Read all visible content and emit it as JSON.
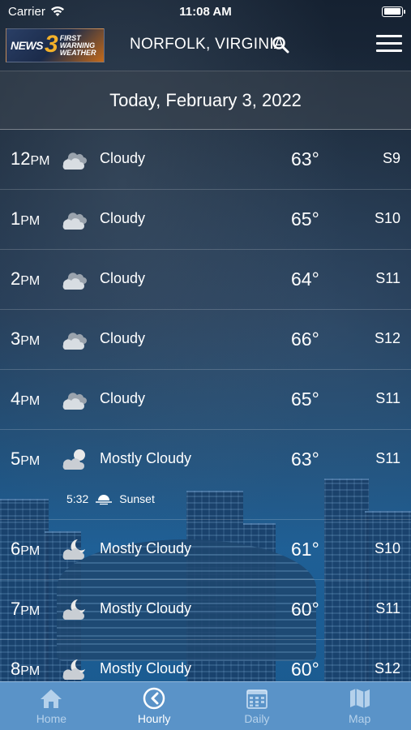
{
  "status_bar": {
    "carrier": "Carrier",
    "time": "11:08 AM"
  },
  "header": {
    "logo_news": "NEWS",
    "logo_number": "3",
    "logo_line1": "FIRST",
    "logo_line2": "WARNING",
    "logo_line3": "WEATHER",
    "location": "NORFOLK, VIRGINIA"
  },
  "date_label": "Today, February 3, 2022",
  "hours": [
    {
      "hour": "12",
      "ampm": "PM",
      "icon": "cloudy-icon",
      "condition": "Cloudy",
      "temp": "63°",
      "wind": "S9"
    },
    {
      "hour": "1",
      "ampm": "PM",
      "icon": "cloudy-icon",
      "condition": "Cloudy",
      "temp": "65°",
      "wind": "S10"
    },
    {
      "hour": "2",
      "ampm": "PM",
      "icon": "cloudy-icon",
      "condition": "Cloudy",
      "temp": "64°",
      "wind": "S11"
    },
    {
      "hour": "3",
      "ampm": "PM",
      "icon": "cloudy-icon",
      "condition": "Cloudy",
      "temp": "66°",
      "wind": "S12"
    },
    {
      "hour": "4",
      "ampm": "PM",
      "icon": "cloudy-icon",
      "condition": "Cloudy",
      "temp": "65°",
      "wind": "S11"
    },
    {
      "hour": "5",
      "ampm": "PM",
      "icon": "mostly-cloudy-day-icon",
      "condition": "Mostly Cloudy",
      "temp": "63°",
      "wind": "S11"
    },
    {
      "hour": "6",
      "ampm": "PM",
      "icon": "mostly-cloudy-night-icon",
      "condition": "Mostly Cloudy",
      "temp": "61°",
      "wind": "S10"
    },
    {
      "hour": "7",
      "ampm": "PM",
      "icon": "mostly-cloudy-night-icon",
      "condition": "Mostly Cloudy",
      "temp": "60°",
      "wind": "S11"
    },
    {
      "hour": "8",
      "ampm": "PM",
      "icon": "mostly-cloudy-night-icon",
      "condition": "Mostly Cloudy",
      "temp": "60°",
      "wind": "S12"
    }
  ],
  "sunset": {
    "time": "5:32",
    "label": "Sunset"
  },
  "tabs": [
    {
      "label": "Home",
      "icon": "home-icon"
    },
    {
      "label": "Hourly",
      "icon": "clock-icon"
    },
    {
      "label": "Daily",
      "icon": "calendar-icon"
    },
    {
      "label": "Map",
      "icon": "map-icon"
    }
  ],
  "colors": {
    "tabbar": "#5a93c8",
    "logo_accent": "#f2b02a"
  }
}
